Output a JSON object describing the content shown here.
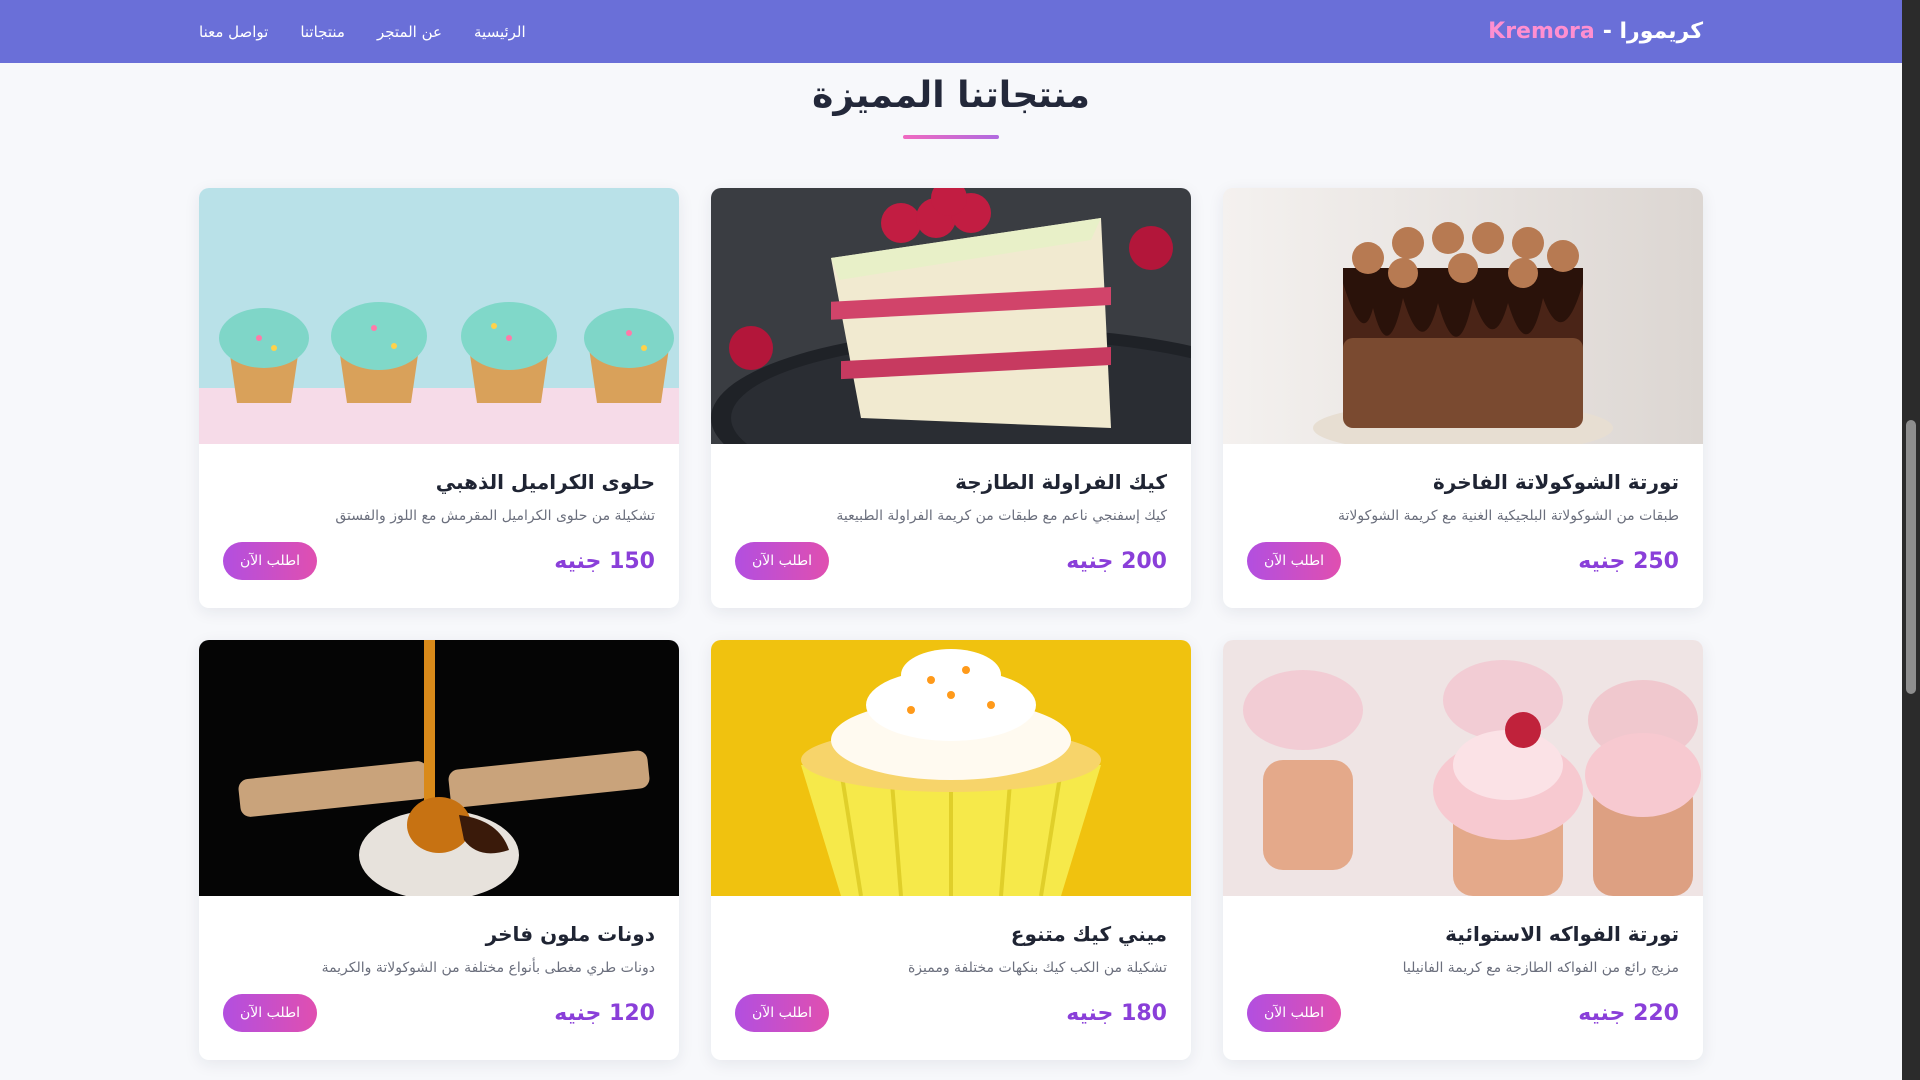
{
  "brand": {
    "arabic": "كريمورا -",
    "latin": "Kremora"
  },
  "nav": [
    "الرئيسية",
    "عن المتجر",
    "منتجاتنا",
    "تواصل معنا"
  ],
  "section": {
    "title": "منتجاتنا المميزة"
  },
  "order_label": "اطلب الآن",
  "products": [
    {
      "title": "تورتة الشوكولاتة الفاخرة",
      "desc": "طبقات من الشوكولاتة البلجيكية الغنية مع كريمة الشوكولاتة",
      "price": "250 جنيه",
      "image": "chocolate-cake"
    },
    {
      "title": "كيك الفراولة الطازجة",
      "desc": "كيك إسفنجي ناعم مع طبقات من كريمة الفراولة الطبيعية",
      "price": "200 جنيه",
      "image": "strawberry-cake-slice"
    },
    {
      "title": "حلوى الكراميل الذهبي",
      "desc": "تشكيلة من حلوى الكراميل المقرمش مع اللوز والفستق",
      "price": "150 جنيه",
      "image": "mint-cupcakes"
    },
    {
      "title": "تورتة الفواكه الاستوائية",
      "desc": "مزيج رائع من الفواكه الطازجة مع كريمة الفانيليا",
      "price": "220 جنيه",
      "image": "pink-cupcakes"
    },
    {
      "title": "ميني كيك متنوع",
      "desc": "تشكيلة من الكب كيك بنكهات مختلفة ومميزة",
      "price": "180 جنيه",
      "image": "yellow-cupcake"
    },
    {
      "title": "دونات ملون فاخر",
      "desc": "دونات طري مغطى بأنواع مختلفة من الشوكولاتة والكريمة",
      "price": "120 جنيه",
      "image": "caramel-dessert"
    }
  ],
  "colors": {
    "navbar": "#6a6fd8",
    "accent": "#8a3fd9",
    "brand_latin": "#ff8fd0"
  }
}
